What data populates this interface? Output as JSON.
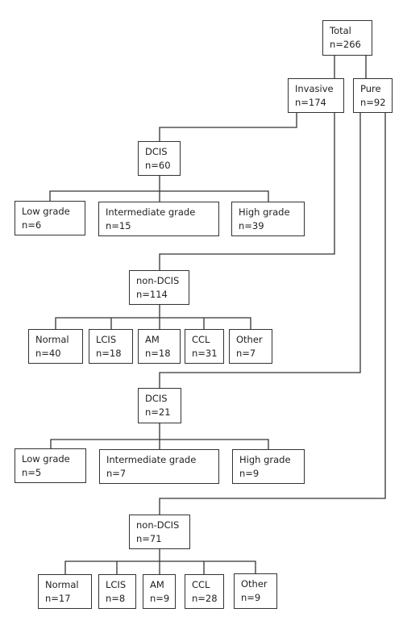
{
  "nodes": {
    "total": {
      "label": "Total",
      "n": "n=266"
    },
    "invasive": {
      "label": "Invasive",
      "n": "n=174"
    },
    "pure": {
      "label": "Pure",
      "n": "n=92"
    },
    "inv_dcis": {
      "label": "DCIS",
      "n": "n=60"
    },
    "inv_dcis_low": {
      "label": "Low grade",
      "n": "n=6"
    },
    "inv_dcis_int": {
      "label": "Intermediate grade",
      "n": "n=15"
    },
    "inv_dcis_high": {
      "label": "High grade",
      "n": "n=39"
    },
    "inv_non": {
      "label": "non-DCIS",
      "n": "n=114"
    },
    "inv_non_normal": {
      "label": "Normal",
      "n": "n=40"
    },
    "inv_non_lcis": {
      "label": "LCIS",
      "n": "n=18"
    },
    "inv_non_am": {
      "label": "AM",
      "n": "n=18"
    },
    "inv_non_ccl": {
      "label": "CCL",
      "n": "n=31"
    },
    "inv_non_other": {
      "label": "Other",
      "n": "n=7"
    },
    "pure_dcis": {
      "label": "DCIS",
      "n": "n=21"
    },
    "pure_dcis_low": {
      "label": "Low grade",
      "n": "n=5"
    },
    "pure_dcis_int": {
      "label": "Intermediate grade",
      "n": "n=7"
    },
    "pure_dcis_high": {
      "label": "High grade",
      "n": "n=9"
    },
    "pure_non": {
      "label": "non-DCIS",
      "n": "n=71"
    },
    "pure_non_normal": {
      "label": "Normal",
      "n": "n=17"
    },
    "pure_non_lcis": {
      "label": "LCIS",
      "n": "n=8"
    },
    "pure_non_am": {
      "label": "AM",
      "n": "n=9"
    },
    "pure_non_ccl": {
      "label": "CCL",
      "n": "n=28"
    },
    "pure_non_other": {
      "label": "Other",
      "n": "n=9"
    }
  }
}
